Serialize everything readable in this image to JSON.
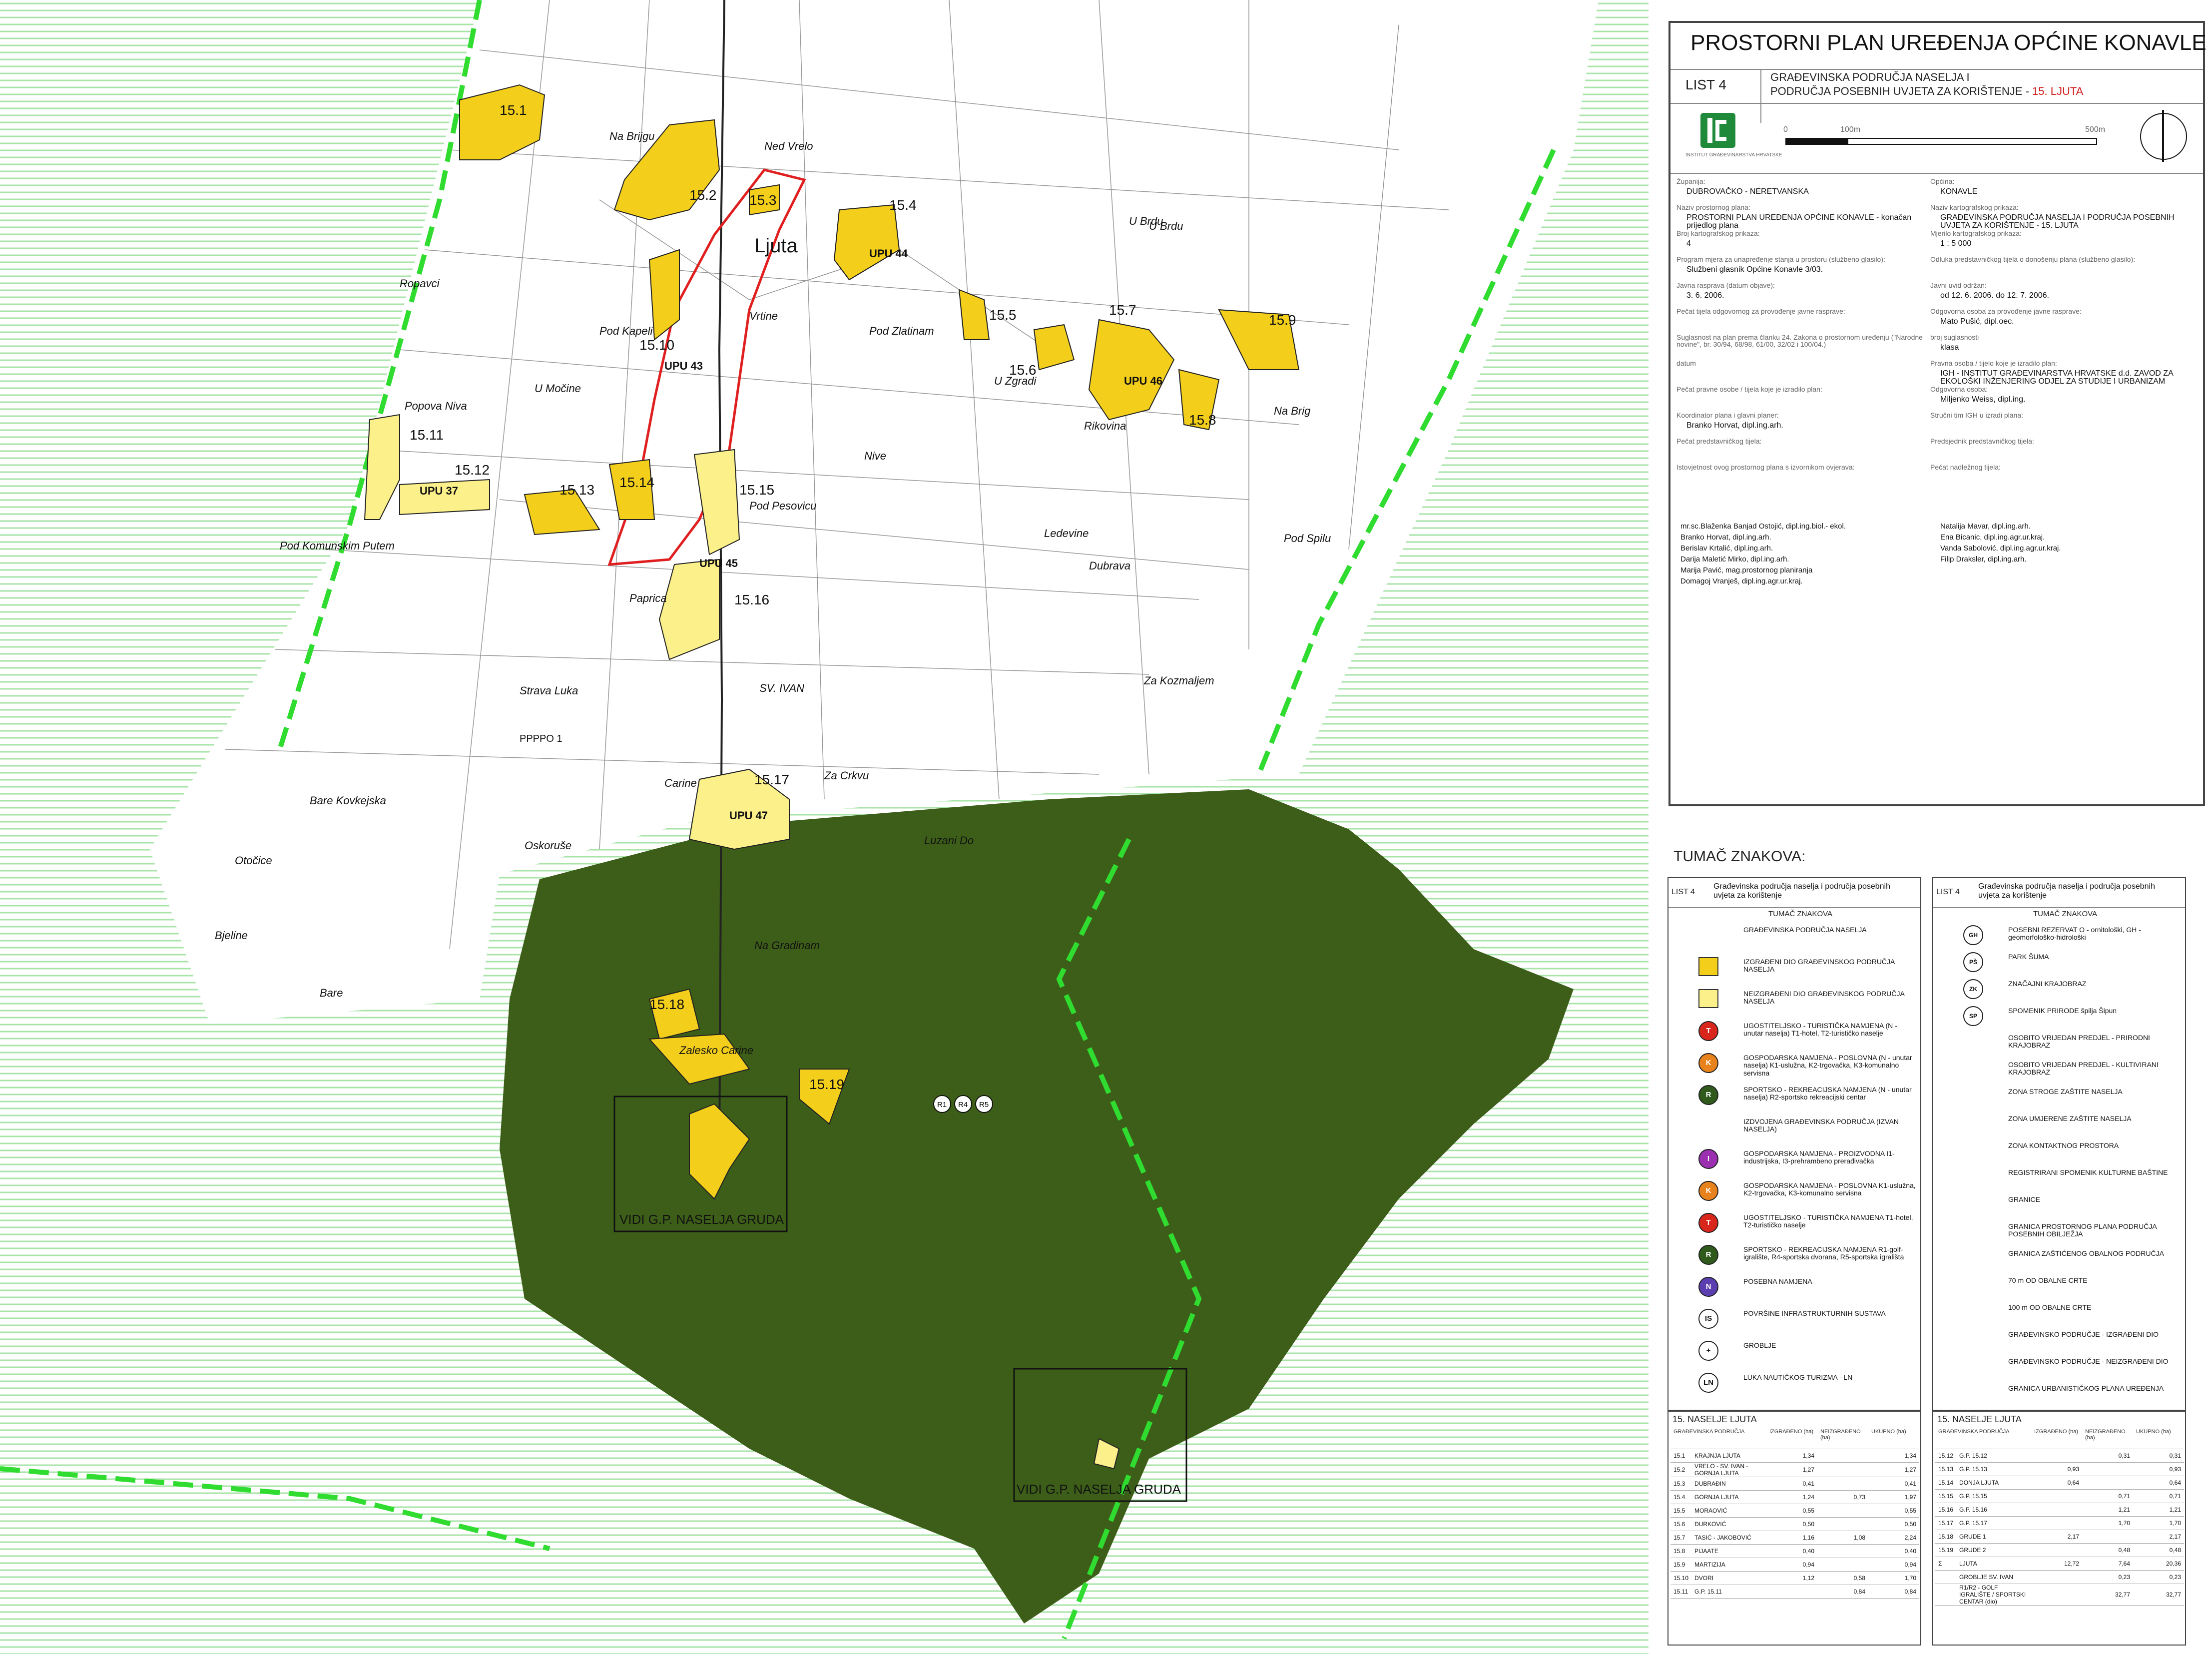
{
  "title_block": {
    "title": "PROSTORNI PLAN UREĐENJA OPĆINE KONAVLE",
    "sheet_label": "LIST 4",
    "sheet_subtitle_1": "GRAĐEVINSKA PODRUČJA NASELJA I",
    "sheet_subtitle_2": "PODRUČJA POSEBNIH UVJETA ZA KORIŠTENJE - ",
    "sheet_subtitle_accent": "15. LJUTA",
    "scale_bar": {
      "zero": "0",
      "mid": "100m",
      "end": "500m"
    },
    "logo_caption": "INSTITUT GRAĐEVINARSTVA HRVATSKE",
    "fields": [
      {
        "label": "Županija:",
        "value": "DUBROVAČKO - NERETVANSKA"
      },
      {
        "label": "Općina:",
        "value": "KONAVLE"
      },
      {
        "label": "Naziv prostornog plana:",
        "value": "PROSTORNI PLAN UREĐENJA OPĆINE KONAVLE - konačan prijedlog plana"
      },
      {
        "label": "Naziv kartografskog prikaza:",
        "value": "GRAĐEVINSKA PODRUČJA NASELJA I PODRUČJA POSEBNIH UVJETA ZA KORIŠTENJE - 15. LJUTA"
      },
      {
        "label": "Broj kartografskog prikaza:",
        "value": "4"
      },
      {
        "label": "Mjerilo kartografskog prikaza:",
        "value": "1 : 5 000"
      },
      {
        "label": "Program mjera za unapređenje stanja u prostoru (službeno glasilo):",
        "value": "Službeni glasnik Općine Konavle 3/03."
      },
      {
        "label": "Odluka predstavničkog tijela o donošenju plana (službeno glasilo):",
        "value": ""
      },
      {
        "label": "Javna rasprava (datum objave):",
        "value": "3. 6. 2006."
      },
      {
        "label": "Javni uvid održan:",
        "value": "od 12. 6. 2006. do 12. 7. 2006."
      },
      {
        "label": "Pečat tijela odgovornog za provođenje javne rasprave:",
        "value": ""
      },
      {
        "label": "Odgovorna osoba za provođenje javne rasprave:",
        "value": "Mato Pušić, dipl.oec."
      },
      {
        "label": "Suglasnost na plan prema članku 24. Zakona o prostornom uređenju (\"Narodne novine\", br. 30/94, 68/98, 61/00, 32/02 i 100/04.)",
        "value": ""
      },
      {
        "label": "broj suglasnosti",
        "value": "klasa"
      },
      {
        "label": "datum",
        "value": ""
      },
      {
        "label": "Pravna osoba / tijelo koje je izradilo plan:",
        "value": "IGH - INSTITUT GRAĐEVINARSTVA HRVATSKE d.d. ZAVOD ZA EKOLOŠKI INŽENJERING ODJEL ZA STUDIJE I URBANIZAM"
      },
      {
        "label": "Pečat pravne osobe / tijela koje je izradilo plan:",
        "value": ""
      },
      {
        "label": "Odgovorna osoba:",
        "value": "Miljenko Weiss, dipl.ing."
      },
      {
        "label": "Koordinator plana i glavni planer:",
        "value": "Branko Horvat, dipl.ing.arh."
      },
      {
        "label": "Stručni tim IGH u izradi plana:",
        "value": ""
      },
      {
        "label": "Pečat predstavničkog tijela:",
        "value": ""
      },
      {
        "label": "Predsjednik predstavničkog tijela:",
        "value": ""
      },
      {
        "label": "Istovjetnost ovog prostornog plana s izvornikom ovjerava:",
        "value": ""
      },
      {
        "label": "Pečat nadležnog tijela:",
        "value": ""
      }
    ],
    "team_left": [
      "mr.sc.Blaženka Banjad Ostojić, dipl.ing.biol.- ekol.",
      "Branko Horvat, dipl.ing.arh.",
      "Berislav Krtalić, dipl.ing.arh.",
      "Darija Maletić Mirko, dipl.ing.arh.",
      "Marija Pavić, mag.prostornog planiranja",
      "Domagoj Vranješ, dipl.ing.agr.ur.kraj."
    ],
    "team_right": [
      "Natalija Mavar, dipl.ing.arh.",
      "Ena Bicanic, dipl.ing.agr.ur.kraj.",
      "Vanda Sabolović, dipl.ing.agr.ur.kraj.",
      "Filip Draksler, dipl.ing.arh."
    ]
  },
  "legend": {
    "heading": "TUMAČ ZNAKOVA:",
    "col_header_sheet": "LIST 4",
    "col_header_title": "Građevinska područja naselja i područja posebnih uvjeta za korištenje",
    "col_sub": "TUMAČ ZNAKOVA",
    "left_items": [
      {
        "text": "GRAĐEVINSKA PODRUČJA NASELJA"
      },
      {
        "text": "IZGRAĐENI DIO GRAĐEVINSKOG PODRUČJA NASELJA",
        "color": "#f3cf1b"
      },
      {
        "text": "NEIZGRAĐENI DIO GRAĐEVINSKOG PODRUČJA NASELJA",
        "color": "#fbf08a"
      },
      {
        "text": "UGOSTITELJSKO - TURISTIČKA NAMJENA (N - unutar naselja) T1-hotel, T2-turističko naselje",
        "sym": "T",
        "color": "#d9261c"
      },
      {
        "text": "GOSPODARSKA NAMJENA - POSLOVNA (N - unutar naselja) K1-uslužna, K2-trgovačka, K3-komunalno servisna",
        "sym": "K",
        "color": "#e8821c"
      },
      {
        "text": "SPORTSKO - REKREACIJSKA NAMJENA (N - unutar naselja) R2-sportsko rekreacijski centar",
        "sym": "R",
        "color": "#2f5a1c"
      },
      {
        "text": "IZDVOJENA GRAĐEVINSKA PODRUČJA (IZVAN NASELJA)"
      },
      {
        "text": "GOSPODARSKA NAMJENA - PROIZVODNA I1-industrijska, I3-prehrambeno prerađivačka",
        "sym": "I",
        "color": "#9a2fb0"
      },
      {
        "text": "GOSPODARSKA NAMJENA - POSLOVNA K1-uslužna, K2-trgovačka, K3-komunalno servisna",
        "sym": "K",
        "color": "#e8821c"
      },
      {
        "text": "UGOSTITELJSKO - TURISTIČKA NAMJENA T1-hotel, T2-turističko naselje",
        "sym": "T",
        "color": "#d9261c"
      },
      {
        "text": "SPORTSKO - REKREACIJSKA NAMJENA R1-golf-igralište, R4-sportska dvorana, R5-sportska igrališta",
        "sym": "R",
        "color": "#2f5a1c"
      },
      {
        "text": "POSEBNA NAMJENA",
        "sym": "N",
        "color": "#5b3fb0"
      },
      {
        "text": "POVRŠINE INFRASTRUKTURNIH SUSTAVA",
        "sym": "IS",
        "color": "#ffffff"
      },
      {
        "text": "GROBLJE",
        "sym": "+",
        "color": "#ffffff"
      },
      {
        "text": "LUKA NAUTIČKOG TURIZMA - LN",
        "sym": "LN",
        "color": "#ffffff"
      }
    ],
    "right_items": [
      {
        "text": "POSEBNI REZERVAT O - ornitološki, GH - geomorfološko-hidrološki",
        "sym": "GH"
      },
      {
        "text": "PARK ŠUMA",
        "sym": "PŠ"
      },
      {
        "text": "ZNAČAJNI KRAJOBRAZ",
        "sym": "ZK"
      },
      {
        "text": "SPOMENIK PRIRODE špilja Šipun",
        "sym": "SP"
      },
      {
        "text": "OSOBITO VRIJEDAN PREDJEL - PRIRODNI KRAJOBRAZ"
      },
      {
        "text": "OSOBITO VRIJEDAN PREDJEL - KULTIVIRANI KRAJOBRAZ"
      },
      {
        "text": "ZONA STROGE ZAŠTITE NASELJA"
      },
      {
        "text": "ZONA UMJERENE ZAŠTITE NASELJA"
      },
      {
        "text": "ZONA KONTAKTNOG PROSTORA"
      },
      {
        "text": "REGISTRIRANI SPOMENIK KULTURNE BAŠTINE"
      },
      {
        "text": "GRANICE"
      },
      {
        "text": "GRANICA PROSTORNOG PLANA PODRUČJA POSEBNIH OBILJEŽJA"
      },
      {
        "text": "GRANICA ZAŠTIĆENOG OBALNOG PODRUČJA"
      },
      {
        "text": "70 m OD OBALNE CRTE"
      },
      {
        "text": "100 m OD OBALNE CRTE"
      },
      {
        "text": "GRAĐEVINSKO PODRUČJE - IZGRAĐENI DIO"
      },
      {
        "text": "GRAĐEVINSKO PODRUČJE - NEIZGRAĐENI DIO"
      },
      {
        "text": "GRANICA URBANISTIČKOG PLANA UREĐENJA"
      }
    ]
  },
  "area_tables": {
    "left": {
      "title": "15. NASELJE LJUTA",
      "headers": [
        "GRAĐEVINSKA PODRUČJA",
        "IZGRAĐENO (ha)",
        "NEIZGRAĐENO (ha)",
        "UKUPNO (ha)"
      ],
      "rows": [
        [
          "15.1",
          "KRAJNJA LJUTA",
          "1,34",
          "",
          "1,34"
        ],
        [
          "15.2",
          "VRELO - SV. IVAN - GORNJA LJUTA",
          "1,27",
          "",
          "1,27"
        ],
        [
          "15.3",
          "DUBRAĐIN",
          "0,41",
          "",
          "0,41"
        ],
        [
          "15.4",
          "GORNJA LJUTA",
          "1,24",
          "0,73",
          "1,97"
        ],
        [
          "15.5",
          "MORAOVIĆ",
          "0,55",
          "",
          "0,55"
        ],
        [
          "15.6",
          "ĐURKOVIĆ",
          "0,50",
          "",
          "0,50"
        ],
        [
          "15.7",
          "TASIĆ - JAKOBOVIĆ",
          "1,16",
          "1,08",
          "2,24"
        ],
        [
          "15.8",
          "PIJAATE",
          "0,40",
          "",
          "0,40"
        ],
        [
          "15.9",
          "MARTIZIJA",
          "0,94",
          "",
          "0,94"
        ],
        [
          "15.10",
          "DVORI",
          "1,12",
          "0,58",
          "1,70"
        ],
        [
          "15.11",
          "G.P. 15.11",
          "",
          "0,84",
          "0,84"
        ]
      ]
    },
    "right": {
      "title": "15. NASELJE LJUTA",
      "headers": [
        "GRAĐEVINSKA PODRUČJA",
        "IZGRAĐENO (ha)",
        "NEIZGRAĐENO (ha)",
        "UKUPNO (ha)"
      ],
      "rows": [
        [
          "15.12",
          "G.P. 15.12",
          "",
          "0,31",
          "0,31"
        ],
        [
          "15.13",
          "G.P. 15.13",
          "0,93",
          "",
          "0,93"
        ],
        [
          "15.14",
          "DONJA LJUTA",
          "0,64",
          "",
          "0,64"
        ],
        [
          "15.15",
          "G.P. 15.15",
          "",
          "0,71",
          "0,71"
        ],
        [
          "15.16",
          "G.P. 15.16",
          "",
          "1,21",
          "1,21"
        ],
        [
          "15.17",
          "G.P. 15.17",
          "",
          "1,70",
          "1,70"
        ],
        [
          "15.18",
          "GRUDE 1",
          "2,17",
          "",
          "2,17"
        ],
        [
          "15.19",
          "GRUDE 2",
          "",
          "0,48",
          "0,48"
        ],
        [
          "Σ",
          "LJUTA",
          "12,72",
          "7,64",
          "20,36"
        ],
        [
          "",
          "GROBLJE SV. IVAN",
          "",
          "0,23",
          "0,23"
        ],
        [
          "",
          "R1/R2 - GOLF IGRALIŠTE / SPORTSKI CENTAR (dio)",
          "",
          "32,77",
          "32,77"
        ]
      ]
    }
  },
  "map": {
    "zones": [
      {
        "id": "15.1",
        "label": "15.1"
      },
      {
        "id": "15.2",
        "label": "15.2"
      },
      {
        "id": "15.3",
        "label": "15.3"
      },
      {
        "id": "15.4",
        "label": "15.4"
      },
      {
        "id": "15.5",
        "label": "15.5"
      },
      {
        "id": "15.6",
        "label": "15.6"
      },
      {
        "id": "15.7",
        "label": "15.7"
      },
      {
        "id": "15.8",
        "label": "15.8"
      },
      {
        "id": "15.9",
        "label": "15.9"
      },
      {
        "id": "15.10",
        "label": "15.10"
      },
      {
        "id": "15.11",
        "label": "15.11"
      },
      {
        "id": "15.12",
        "label": "15.12"
      },
      {
        "id": "15.13",
        "label": "15.13"
      },
      {
        "id": "15.14",
        "label": "15.14"
      },
      {
        "id": "15.15",
        "label": "15.15"
      },
      {
        "id": "15.16",
        "label": "15.16"
      },
      {
        "id": "15.17",
        "label": "15.17"
      },
      {
        "id": "15.18",
        "label": "15.18"
      },
      {
        "id": "15.19",
        "label": "15.19"
      }
    ],
    "upu_labels": [
      "UPU 44",
      "UPU 43",
      "UPU 46",
      "UPU 37",
      "UPU 45",
      "UPU 47"
    ],
    "place_names": [
      "Na Brijgu",
      "U Brdu",
      "Ned Vrelo",
      "U Brdu",
      "Ljuta",
      "Vrtine",
      "Pod Zlatinam",
      "Pod Kapeli",
      "Ropavci",
      "U Močine",
      "Popova Niva",
      "U Zgradi",
      "Rikovina",
      "Na Brig",
      "Nive",
      "Pod Pesovicu",
      "Pod Komunskim Putem",
      "Pod Spilu",
      "Ledevine",
      "Paprica",
      "Dubrava",
      "Strava Luka",
      "SV. IVAN",
      "Za Kozmaljem",
      "Carine",
      "Za Crkvu",
      "Bare Kovkejska",
      "Oskoruše",
      "Otočice",
      "Bjeline",
      "Na Gradinam",
      "Zalesko Carine",
      "Luzani Do",
      "Bare"
    ],
    "inset_labels": [
      "VIDI G.P. NASELJA GRUDA",
      "VIDI G.P. NASELJA GRUDA"
    ],
    "sport_symbols": [
      "R1",
      "R4",
      "R5"
    ],
    "pppo_label": "PPPPO 1",
    "colors": {
      "built": "#f3cf1b",
      "unbuilt": "#fbf08a",
      "forest": "#3d5e19",
      "boundary": "#2fdc2f",
      "protect": "#e02020",
      "hatch": "#9be09b"
    }
  }
}
